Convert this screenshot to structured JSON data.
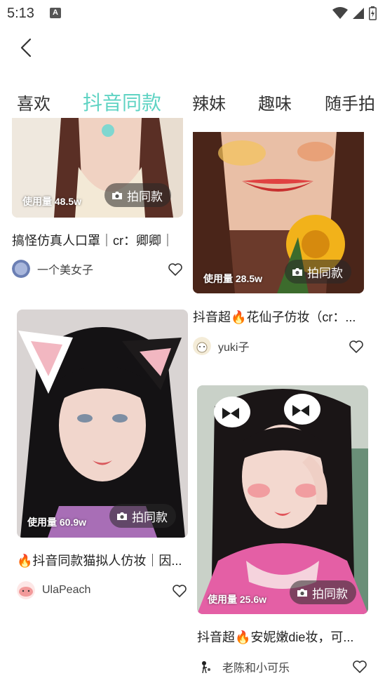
{
  "status_bar": {
    "time": "5:13",
    "indicator": "A"
  },
  "tabs": [
    {
      "label": "喜欢",
      "active": false
    },
    {
      "label": "抖音同款",
      "active": true
    },
    {
      "label": "辣妹",
      "active": false
    },
    {
      "label": "趣味",
      "active": false
    },
    {
      "label": "随手拍",
      "active": false
    }
  ],
  "accent_color": "#5fd3c3",
  "shoot_same_label": "拍同款",
  "cards": [
    {
      "usage": "使用量 48.5w",
      "title": "搞怪仿真人口罩｜cr：卿卿｜",
      "author": "一个美女子",
      "liked": false
    },
    {
      "usage": "使用量 28.5w",
      "title": "抖音超🔥花仙子仿妆（cr：...",
      "author": "yuki子",
      "liked": false
    },
    {
      "usage": "使用量 60.9w",
      "title": "🔥抖音同款猫拟人仿妆｜因...",
      "author": "UlaPeach",
      "liked": false
    },
    {
      "usage": "使用量 25.6w",
      "title": "抖音超🔥安妮嫩die妆，可...",
      "author": "老陈和小可乐",
      "liked": false
    }
  ]
}
